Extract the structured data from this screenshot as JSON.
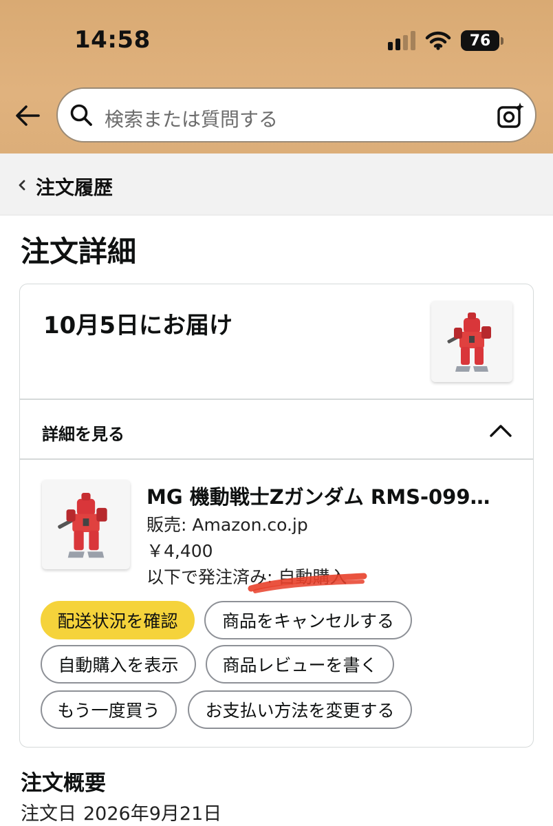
{
  "status_bar": {
    "time": "14:58",
    "battery": "76",
    "icons": [
      "cellular-signal-icon",
      "wifi-icon",
      "battery-icon"
    ]
  },
  "header": {
    "search_placeholder": "検索または質問する",
    "icons": [
      "back-arrow-icon",
      "search-icon",
      "camera-search-icon"
    ],
    "background_color": "#dcae79"
  },
  "breadcrumb": {
    "label": "注文履歴"
  },
  "page": {
    "title": "注文詳細"
  },
  "shipment": {
    "delivery_date": "10月5日にお届け",
    "details_toggle": "詳細を見る",
    "item": {
      "title": "MG 機動戦士Zガンダム RMS-099…",
      "seller": "販売: Amazon.co.jp",
      "price": "￥4,400",
      "ordered_via": "以下で発注済み: 自動購入"
    },
    "buttons": {
      "track": "配送状況を確認",
      "cancel": "商品をキャンセルする",
      "view_autobuy": "自動購入を表示",
      "write_review": "商品レビューを書く",
      "buy_again": "もう一度買う",
      "change_payment": "お支払い方法を変更する"
    },
    "primary_color": "#f5d33b"
  },
  "summary": {
    "title": "注文概要",
    "order_date_label": "注文日",
    "order_date_value": "2026年9月21日"
  }
}
